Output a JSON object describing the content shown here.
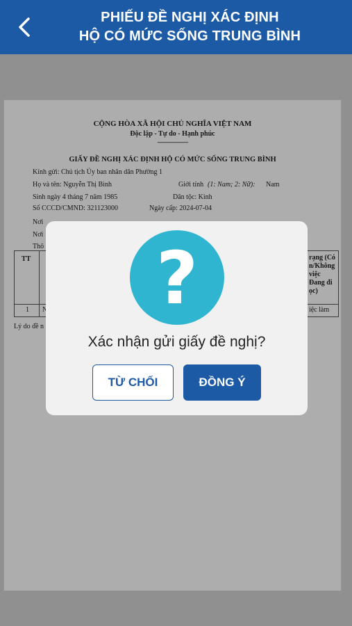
{
  "header": {
    "title_line1": "PHIẾU ĐỀ NGHỊ XÁC ĐỊNH",
    "title_line2": "HỘ CÓ MỨC SỐNG TRUNG BÌNH",
    "back_icon": "chevron-left-icon"
  },
  "document": {
    "nation": "CỘNG HÒA XÃ HỘI CHỦ NGHĨA VIỆT NAM",
    "motto": "Độc lập - Tự do - Hạnh phúc",
    "separator": "----------------------",
    "form_title": "GIẤY ĐỀ NGHỊ XÁC ĐỊNH HỘ CÓ MỨC SỐNG TRUNG BÌNH",
    "recipient": "Kính gửi: Chủ tịch Ủy ban nhân dân Phường 1",
    "fullname": "Họ và tên: Nguyễn Thị Bình",
    "gender_label": "Giới tính",
    "gender_hint": "(1: Nam; 2: Nữ):",
    "gender_value": "Nam",
    "dob": "Sinh ngày 4 tháng 7 năm 1985",
    "ethnicity": "Dân tộc: Kinh",
    "id_number": "Số CCCD/CMND: 321123000",
    "issue_date": "Ngày cấp: 2024-07-04",
    "residence_prefix": "Nơi",
    "current_prefix": "Nơi",
    "info_prefix": "Thô",
    "table_header_tt": "TT",
    "table_header_status": "rạng (Có\nn/Không\nviệc\nĐang đi\nọc)",
    "table_row_tt": "1",
    "table_row_n": "N",
    "table_row_status": "iệc làm",
    "reason_prefix": "Lý do đề n"
  },
  "dialog": {
    "icon": "question-mark-icon",
    "icon_glyph": "?",
    "message": "Xác nhận gửi giấy đề nghị?",
    "reject_label": "TỪ CHỐI",
    "accept_label": "ĐỒNG Ý"
  },
  "colors": {
    "primary": "#1d5aa6",
    "icon_circle": "#30b5d1",
    "dialog_bg": "#f1f1f1"
  }
}
